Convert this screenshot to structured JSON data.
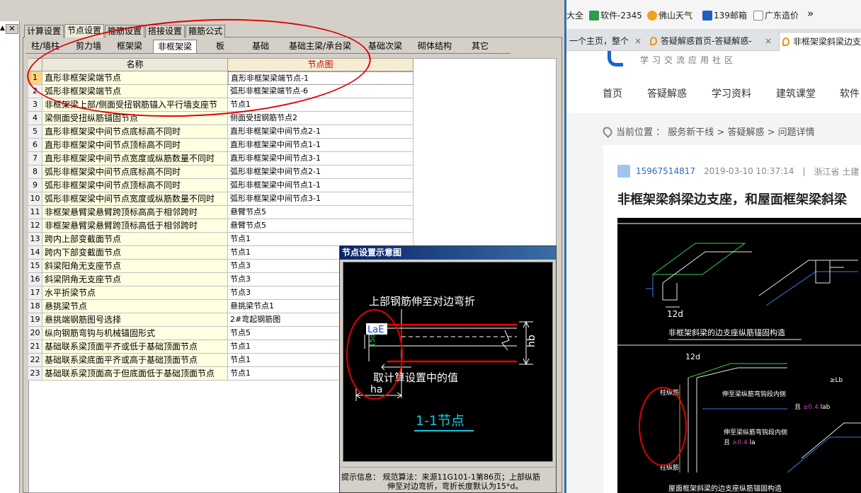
{
  "left_app": {
    "main_tabs": [
      "计算设置",
      "节点设置",
      "箍筋设置",
      "搭接设置",
      "箍筋公式"
    ],
    "main_tab_active": 1,
    "sub_tabs": [
      "柱/墙柱",
      "剪力墙",
      "框架梁",
      "非框架梁",
      "板",
      "基础",
      "基础主梁/承台梁",
      "基础次梁",
      "砌体结构",
      "其它"
    ],
    "sub_tab_active": 3,
    "close_glyph": "✕",
    "left_marker": "▲",
    "grid": {
      "headers": [
        "",
        "名称",
        "节点图"
      ],
      "rows": [
        {
          "n": "1",
          "name": "直形非框架梁端节点",
          "node": "直形非框架梁端节点-1"
        },
        {
          "n": "2",
          "name": "弧形非框架梁端节点",
          "node": "弧形非框架梁端节点-6"
        },
        {
          "n": "3",
          "name": "非框架梁上部/侧面受扭钢筋锚入平行墙支座节",
          "node": "节点1"
        },
        {
          "n": "4",
          "name": "梁侧面受扭纵筋锚固节点",
          "node": "侧面受扭钢筋节点2"
        },
        {
          "n": "5",
          "name": "直形非框架梁中间节点底标高不同时",
          "node": "直形非框架梁中间节点2-1"
        },
        {
          "n": "6",
          "name": "直形非框架梁中间节点顶标高不同时",
          "node": "直形非框架梁中间节点1-1"
        },
        {
          "n": "7",
          "name": "直形非框架梁中间节点宽度或纵筋数量不同时",
          "node": "直形非框架梁中间节点3-1"
        },
        {
          "n": "8",
          "name": "弧形非框架梁中间节点底标高不同时",
          "node": "弧形非框架梁中间节点2-1"
        },
        {
          "n": "9",
          "name": "弧形非框架梁中间节点顶标高不同时",
          "node": "弧形非框架梁中间节点1-1"
        },
        {
          "n": "10",
          "name": "弧形非框架梁中间节点宽度或纵筋数量不同时",
          "node": "弧形非框架梁中间节点3-1"
        },
        {
          "n": "11",
          "name": "非框架悬臂梁悬臂跨顶标高高于相邻跨时",
          "node": "悬臂节点5"
        },
        {
          "n": "12",
          "name": "非框架悬臂梁悬臂跨顶标高低于相邻跨时",
          "node": "悬臂节点5"
        },
        {
          "n": "13",
          "name": "跨内上部变截面节点",
          "node": "节点1"
        },
        {
          "n": "14",
          "name": "跨内下部变截面节点",
          "node": "节点1"
        },
        {
          "n": "15",
          "name": "斜梁阳角无支座节点",
          "node": "节点3"
        },
        {
          "n": "16",
          "name": "斜梁阴角无支座节点",
          "node": "节点3"
        },
        {
          "n": "17",
          "name": "水平折梁节点",
          "node": "节点3"
        },
        {
          "n": "18",
          "name": "悬挑梁节点",
          "node": "悬挑梁节点1"
        },
        {
          "n": "19",
          "name": "悬挑端钢筋图号选择",
          "node": "2#弯起钢筋图"
        },
        {
          "n": "20",
          "name": "纵向钢筋弯钩与机械锚固形式",
          "node": "节点5"
        },
        {
          "n": "21",
          "name": "基础联系梁顶面平齐或低于基础顶面节点",
          "node": "节点1"
        },
        {
          "n": "22",
          "name": "基础联系梁底面平齐或高于基础顶面节点",
          "node": "节点1"
        },
        {
          "n": "23",
          "name": "基础联系梁顶面高于但底面低于基础顶面节点",
          "node": "节点1"
        }
      ]
    },
    "dialog": {
      "title": "节点设置示意图",
      "diagram": {
        "top_text": "上部钢筋伸至对边弯折",
        "lae": "LaE",
        "fifteen_d": "15d",
        "hb": "hb",
        "ha": "ha",
        "mid_text": "取计算设置中的值",
        "caption": "1-1节点"
      },
      "hint_label": "提示信息：",
      "hint_line1": "规范算法：来源11G101-1第86页；上部纵筋",
      "hint_line2": "伸至对边弯折，弯折长度默认为15*d。"
    }
  },
  "browser": {
    "bookmarks": [
      {
        "label": "大全",
        "icon": "none",
        "color": "#ffffff"
      },
      {
        "label": "软件-2345",
        "icon": "2345-icon",
        "color": "#2f9b4a"
      },
      {
        "label": "佛山天气",
        "icon": "weather-icon",
        "color": "#f0a020"
      },
      {
        "label": "139邮箱",
        "icon": "mail-139-icon",
        "color": "#1f5fbf"
      },
      {
        "label": "广东造价",
        "icon": "page-icon",
        "color": "#8a8a8a"
      },
      {
        "label": "»",
        "icon": "none",
        "color": "#ffffff"
      }
    ],
    "tabs": [
      {
        "label": "一个主页，整个",
        "close": "×"
      },
      {
        "label": "答疑解惑首页-答疑解惑-",
        "close": "×"
      },
      {
        "label": "非框架梁斜梁边支",
        "close": ""
      }
    ],
    "site": {
      "slogan": "学习交流应用社区",
      "nav": [
        "首页",
        "答疑解惑",
        "学习资料",
        "建筑课堂",
        "软件"
      ],
      "breadcrumb_prefix": "当前位置 ：",
      "breadcrumb": "服务新干线 > 答疑解惑 > 问题详情",
      "user": "15967514817",
      "datetime": "2019-03-10 10:37:14",
      "separator": "|",
      "location": "浙江省",
      "trade": "土建",
      "title": "非框架梁斜梁边支座，和屋面框架梁斜梁",
      "cad_texts": {
        "t1": "非框架斜梁的边支座纵筋锚固构造",
        "t2": "12d",
        "t3": "屋面框架斜梁的边支座纵筋锚固构造",
        "t4": "伸至梁纵筋弯钩段内侧",
        "t5": "且",
        "t6": "≥0.4",
        "t7": "la",
        "t8": "伸至梁纵筋弯钩段内侧",
        "t9": "且",
        "t10": "≥0.4",
        "t11": "lab",
        "t12": "柱纵筋",
        "t13": "柱纵筋",
        "t14": "≥Lb"
      }
    }
  },
  "colors": {
    "annotation_ring": "#e00000",
    "grid_name_bg": "#ffffe1",
    "cad_bg": "#000000",
    "link_blue": "#2d6bb7",
    "header_red": "#c00000"
  }
}
